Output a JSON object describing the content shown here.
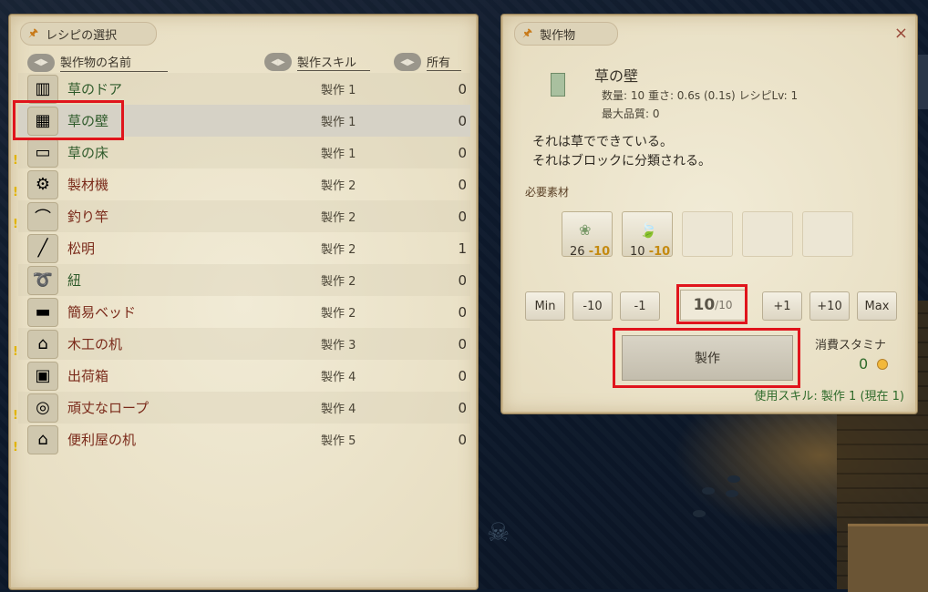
{
  "left_panel": {
    "tab_title": "レシピの選択",
    "columns": {
      "name": "製作物の名前",
      "skill": "製作スキル",
      "owned": "所有"
    },
    "recipes": [
      {
        "name": "草のドア",
        "skill": "製作 1",
        "owned": "0",
        "color": "green",
        "alert": false,
        "icon": "grass-door-icon",
        "glyph": "▥"
      },
      {
        "name": "草の壁",
        "skill": "製作 1",
        "owned": "0",
        "color": "green",
        "alert": false,
        "icon": "grass-wall-icon",
        "glyph": "▦"
      },
      {
        "name": "草の床",
        "skill": "製作 1",
        "owned": "0",
        "color": "green",
        "alert": true,
        "icon": "grass-floor-icon",
        "glyph": "▭"
      },
      {
        "name": "製材機",
        "skill": "製作 2",
        "owned": "0",
        "color": "red",
        "alert": true,
        "icon": "sawmill-icon",
        "glyph": "⚙"
      },
      {
        "name": "釣り竿",
        "skill": "製作 2",
        "owned": "0",
        "color": "red",
        "alert": true,
        "icon": "fishing-rod-icon",
        "glyph": "⌒"
      },
      {
        "name": "松明",
        "skill": "製作 2",
        "owned": "1",
        "color": "red",
        "alert": false,
        "icon": "torch-icon",
        "glyph": "╱"
      },
      {
        "name": "紐",
        "skill": "製作 2",
        "owned": "0",
        "color": "green",
        "alert": false,
        "icon": "string-icon",
        "glyph": "➰"
      },
      {
        "name": "簡易ベッド",
        "skill": "製作 2",
        "owned": "0",
        "color": "red",
        "alert": false,
        "icon": "simple-bed-icon",
        "glyph": "▬"
      },
      {
        "name": "木工の机",
        "skill": "製作 3",
        "owned": "0",
        "color": "red",
        "alert": true,
        "icon": "carpentry-desk-icon",
        "glyph": "⌂"
      },
      {
        "name": "出荷箱",
        "skill": "製作 4",
        "owned": "0",
        "color": "red",
        "alert": false,
        "icon": "shipping-box-icon",
        "glyph": "▣"
      },
      {
        "name": "頑丈なロープ",
        "skill": "製作 4",
        "owned": "0",
        "color": "red",
        "alert": true,
        "icon": "sturdy-rope-icon",
        "glyph": "◎"
      },
      {
        "name": "便利屋の机",
        "skill": "製作 5",
        "owned": "0",
        "color": "red",
        "alert": true,
        "icon": "handyman-desk-icon",
        "glyph": "⌂"
      }
    ]
  },
  "right_panel": {
    "tab_title": "製作物",
    "close": "×",
    "product": {
      "name": "草の壁",
      "meta": "数量: 10  重さ: 0.6s (0.1s)  レシピLv: 1",
      "quality": "最大品質: 0"
    },
    "description": [
      "それは草でできている。",
      "それはブロックに分類される。"
    ],
    "materials_title": "必要素材",
    "materials": [
      {
        "icon": "grass-material-icon",
        "glyph": "❀",
        "have": "26",
        "need": "-10"
      },
      {
        "icon": "leaf-material-icon",
        "glyph": "🍃",
        "have": "10",
        "need": "-10"
      }
    ],
    "buttons": {
      "min": "Min",
      "minus10": "-10",
      "minus1": "-1",
      "plus1": "+1",
      "plus10": "+10",
      "max": "Max"
    },
    "quantity": {
      "value": "10",
      "max": "/10"
    },
    "craft_label": "製作",
    "stamina_label": "消費スタミナ",
    "stamina_value": "0",
    "skill_used": "使用スキル: 製作 1 (現在 1)"
  }
}
